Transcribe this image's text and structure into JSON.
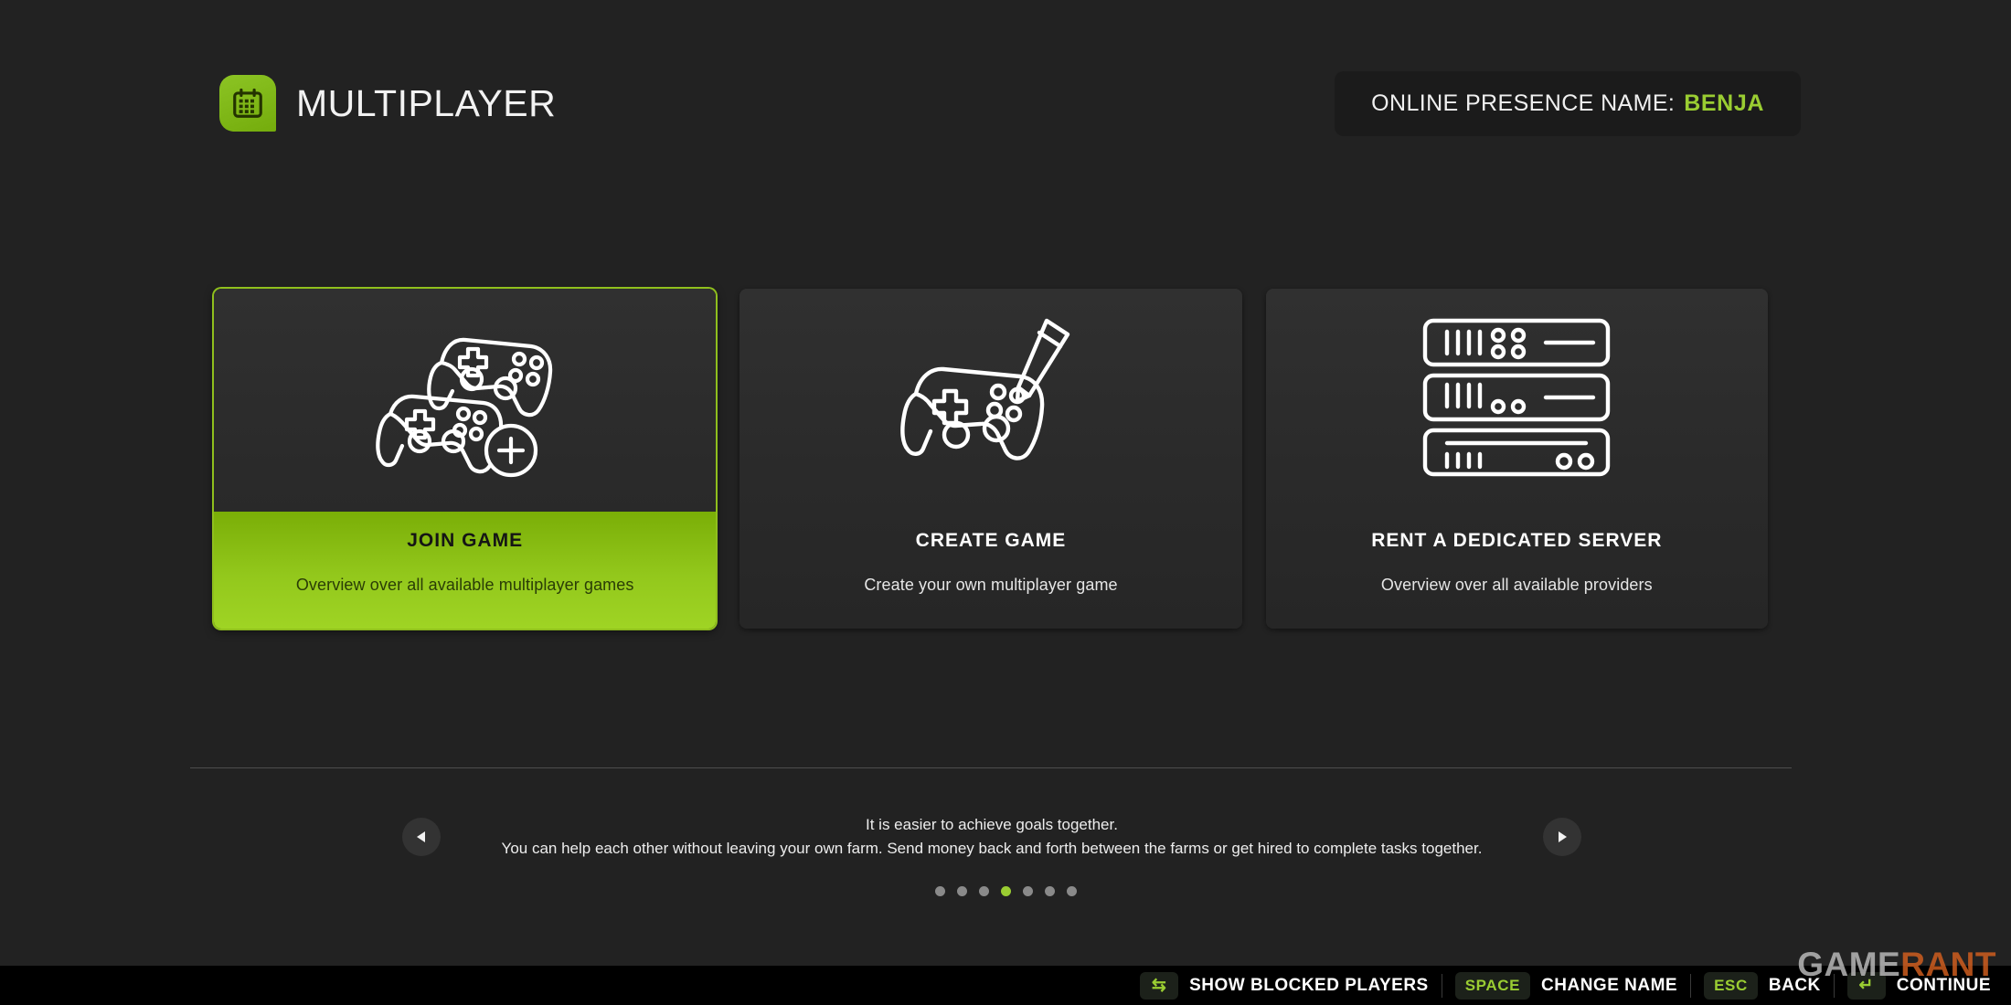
{
  "header": {
    "logo_icon": "calendar-icon",
    "title": "MULTIPLAYER",
    "presence_label": "ONLINE PRESENCE NAME:",
    "presence_value": "BENJA"
  },
  "colors": {
    "accent_green": "#9ACD32",
    "page_bg": "#222222",
    "card_bg": "#2b2b2b",
    "watermark_orange": "#d4601f"
  },
  "cards": [
    {
      "id": "join-game",
      "icon": "two-controllers-plus-icon",
      "title": "JOIN GAME",
      "subtitle": "Overview over all available multiplayer games",
      "selected": true
    },
    {
      "id": "create-game",
      "icon": "controller-pencil-icon",
      "title": "CREATE GAME",
      "subtitle": "Create your own multiplayer game",
      "selected": false
    },
    {
      "id": "rent-dedicated-server",
      "icon": "server-rack-icon",
      "title": "RENT A DEDICATED SERVER",
      "subtitle": "Overview over all available providers",
      "selected": false
    }
  ],
  "tip": {
    "prev_icon": "triangle-left-icon",
    "next_icon": "triangle-right-icon",
    "line1": "It is easier to achieve goals together.",
    "line2": "You can help each other without leaving your own farm. Send money back and forth between the farms or get hired to complete tasks together.",
    "dot_count": 7,
    "active_dot": 4
  },
  "bottom_bar": {
    "hints": [
      {
        "key": "⇆",
        "key_is_glyph": true,
        "key_name": "tab-key-icon",
        "label": "SHOW BLOCKED PLAYERS"
      },
      {
        "key": "SPACE",
        "key_is_glyph": false,
        "key_name": "space-key",
        "label": "CHANGE NAME"
      },
      {
        "key": "ESC",
        "key_is_glyph": false,
        "key_name": "esc-key",
        "label": "BACK"
      },
      {
        "key": "↵",
        "key_is_glyph": true,
        "key_name": "enter-key-icon",
        "label": "CONTINUE"
      }
    ]
  },
  "watermark": {
    "part1": "GAME",
    "part2": "RANT"
  }
}
